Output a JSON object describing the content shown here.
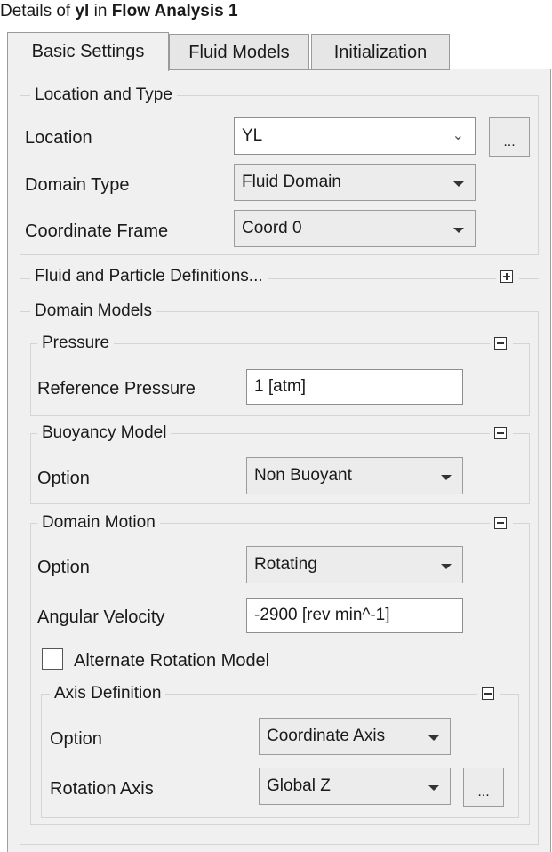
{
  "header": {
    "prefix": "Details of ",
    "object": "yl",
    "middle": " in ",
    "analysis": "Flow Analysis 1"
  },
  "tabs": [
    {
      "label": "Basic Settings",
      "active": true
    },
    {
      "label": "Fluid Models",
      "active": false
    },
    {
      "label": "Initialization",
      "active": false
    }
  ],
  "location_type": {
    "legend": "Location and Type",
    "location_label": "Location",
    "location_value": "YL",
    "domain_type_label": "Domain Type",
    "domain_type_value": "Fluid Domain",
    "coord_frame_label": "Coordinate Frame",
    "coord_frame_value": "Coord 0",
    "more_label": "..."
  },
  "fluid_particle": {
    "legend": "Fluid and Particle Definitions...",
    "expanded": false
  },
  "domain_models": {
    "legend": "Domain Models",
    "pressure": {
      "legend": "Pressure",
      "ref_label": "Reference Pressure",
      "ref_value": "1 [atm]"
    },
    "buoyancy": {
      "legend": "Buoyancy Model",
      "option_label": "Option",
      "option_value": "Non Buoyant"
    },
    "motion": {
      "legend": "Domain Motion",
      "option_label": "Option",
      "option_value": "Rotating",
      "angvel_label": "Angular Velocity",
      "angvel_value": "-2900 [rev min^-1]",
      "alt_rotation_label": "Alternate Rotation Model",
      "alt_rotation_checked": false,
      "axis": {
        "legend": "Axis Definition",
        "option_label": "Option",
        "option_value": "Coordinate Axis",
        "rot_axis_label": "Rotation Axis",
        "rot_axis_value": "Global Z",
        "more_label": "..."
      }
    }
  },
  "colors": {
    "panel_bg": "#f0f0f0",
    "field_bg": "#ffffff",
    "border": "#9b9b9b"
  }
}
